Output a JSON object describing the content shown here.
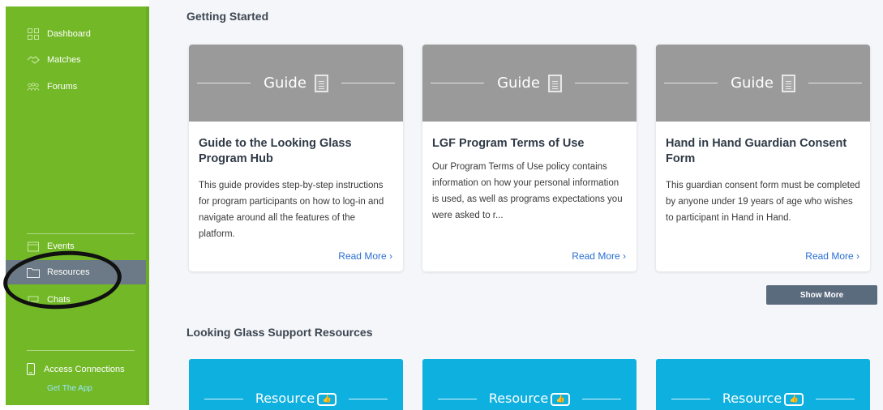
{
  "sidebar": {
    "items": [
      {
        "label": "Dashboard",
        "icon": "grid-icon"
      },
      {
        "label": "Matches",
        "icon": "handshake-icon"
      },
      {
        "label": "Forums",
        "icon": "people-icon"
      },
      {
        "label": "Events",
        "icon": "calendar-icon"
      },
      {
        "label": "Resources",
        "icon": "folder-icon"
      },
      {
        "label": "Chats",
        "icon": "chat-icon"
      }
    ],
    "access_label": "Access Connections",
    "get_app_label": "Get The App"
  },
  "main": {
    "getting_started_title": "Getting Started",
    "cards": [
      {
        "header_label": "Guide",
        "title": "Guide to the Looking Glass Program Hub",
        "description": "This guide provides step-by-step instructions for program participants on how to log-in and navigate around all the features of the platform.",
        "link": "Read More ›"
      },
      {
        "header_label": "Guide",
        "title": "LGF Program Terms of Use",
        "description": "Our Program Terms of Use policy contains information on how your personal information is used, as well as programs expectations you were asked to r...",
        "link": "Read More ›"
      },
      {
        "header_label": "Guide",
        "title": "Hand in Hand Guardian Consent Form",
        "description": "This guardian consent form must be completed by anyone under 19 years of age who wishes to participant in Hand in Hand.",
        "link": "Read More ›"
      }
    ],
    "show_more_label": "Show More",
    "support_title": "Looking Glass Support Resources",
    "resource_cards": [
      {
        "header_label": "Resource"
      },
      {
        "header_label": "Resource"
      },
      {
        "header_label": "Resource"
      }
    ]
  },
  "colors": {
    "sidebar_bg": "#72b827",
    "active_item_bg": "#6b7a86",
    "guide_header_bg": "#9a9a9a",
    "resource_header_bg": "#0db0df",
    "link": "#2a6fd6",
    "show_more_bg": "#5b6b7e"
  }
}
